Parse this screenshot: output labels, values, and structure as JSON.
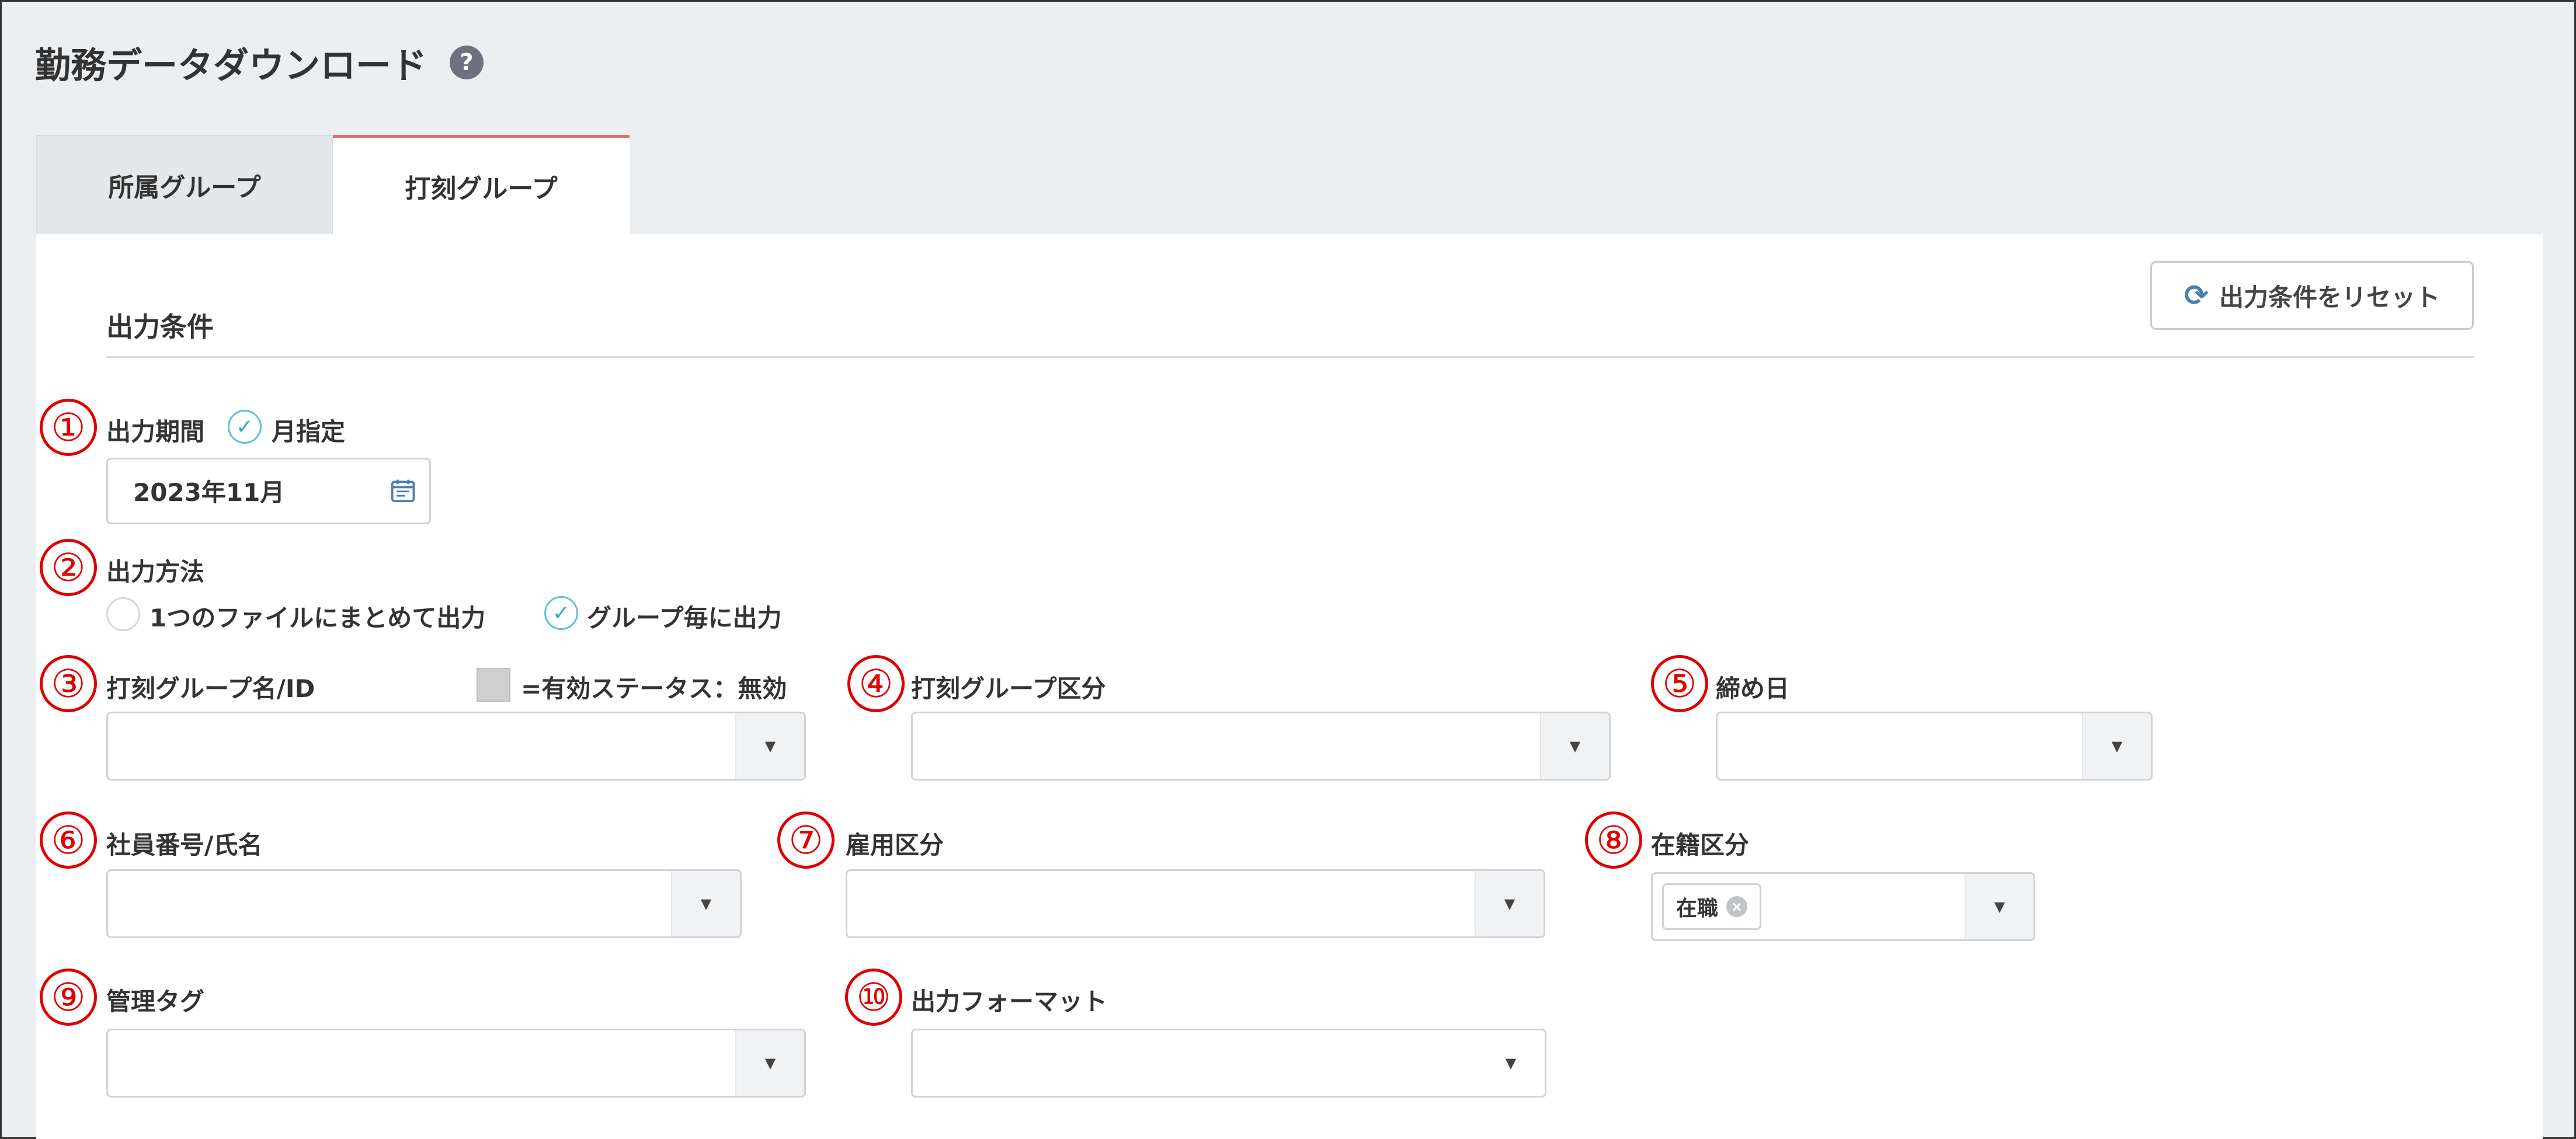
{
  "page": {
    "title": "勤務データダウンロード",
    "help_icon": "?"
  },
  "tabs": [
    {
      "label": "所属グループ",
      "active": false
    },
    {
      "label": "打刻グループ",
      "active": true
    }
  ],
  "section": {
    "title": "出力条件"
  },
  "reset_button": {
    "label": "出力条件をリセット",
    "icon": "refresh-icon"
  },
  "fields": {
    "period": {
      "number": "①",
      "label": "出力期間",
      "option_label": "月指定",
      "value": "2023年11月"
    },
    "method": {
      "number": "②",
      "label": "出力方法",
      "option1": "1つのファイルにまとめて出力",
      "option2": "グループ毎に出力",
      "selected": "グループ毎に出力"
    },
    "group_name": {
      "number": "③",
      "label": "打刻グループ名/ID",
      "legend": "=有効ステータス：無効",
      "value": ""
    },
    "group_type": {
      "number": "④",
      "label": "打刻グループ区分",
      "value": ""
    },
    "closing_day": {
      "number": "⑤",
      "label": "締め日",
      "value": ""
    },
    "employee": {
      "number": "⑥",
      "label": "社員番号/氏名",
      "value": ""
    },
    "employment": {
      "number": "⑦",
      "label": "雇用区分",
      "value": ""
    },
    "enrollment": {
      "number": "⑧",
      "label": "在籍区分",
      "tag": "在職"
    },
    "tag": {
      "number": "⑨",
      "label": "管理タグ",
      "value": ""
    },
    "format": {
      "number": "⑩",
      "label": "出力フォーマット",
      "value": ""
    }
  },
  "colors": {
    "accent": "#e86b6b",
    "check": "#5cc3d6",
    "annotation": "#e00000"
  }
}
